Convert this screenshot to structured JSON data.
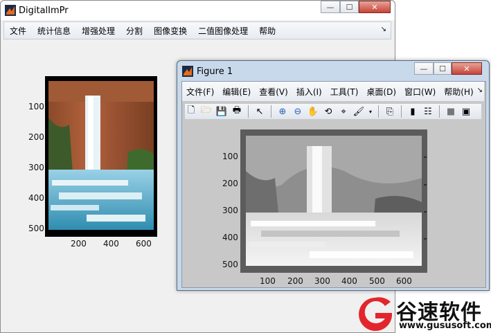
{
  "main_window": {
    "title": "DigitalImPr",
    "menu": [
      "文件",
      "统计信息",
      "增强处理",
      "分割",
      "图像变换",
      "二值图像处理",
      "帮助"
    ],
    "y_ticks": [
      "100",
      "200",
      "300",
      "400",
      "500"
    ],
    "x_ticks": [
      "200",
      "400",
      "600"
    ]
  },
  "figure_window": {
    "title": "Figure 1",
    "menu": [
      "文件(F)",
      "编辑(E)",
      "查看(V)",
      "插入(I)",
      "工具(T)",
      "桌面(D)",
      "窗口(W)",
      "帮助(H)"
    ],
    "toolbar_icons": [
      "new-figure-icon",
      "open-icon",
      "save-icon",
      "print-icon",
      "pointer-icon",
      "zoom-in-icon",
      "zoom-out-icon",
      "pan-icon",
      "rotate-icon",
      "data-cursor-icon",
      "brush-icon",
      "link-icon",
      "colorbar-icon",
      "legend-icon",
      "hide-tools-icon",
      "show-tools-icon"
    ],
    "y_ticks": [
      "100",
      "200",
      "300",
      "400",
      "500"
    ],
    "x_ticks": [
      "100",
      "200",
      "300",
      "400",
      "500",
      "600"
    ]
  },
  "window_controls": {
    "minimize": "—",
    "maximize": "☐",
    "close": "✕"
  },
  "watermark": {
    "brand": "谷速软件",
    "url": "www.gususoft.com",
    "accent": "#e3262c"
  }
}
